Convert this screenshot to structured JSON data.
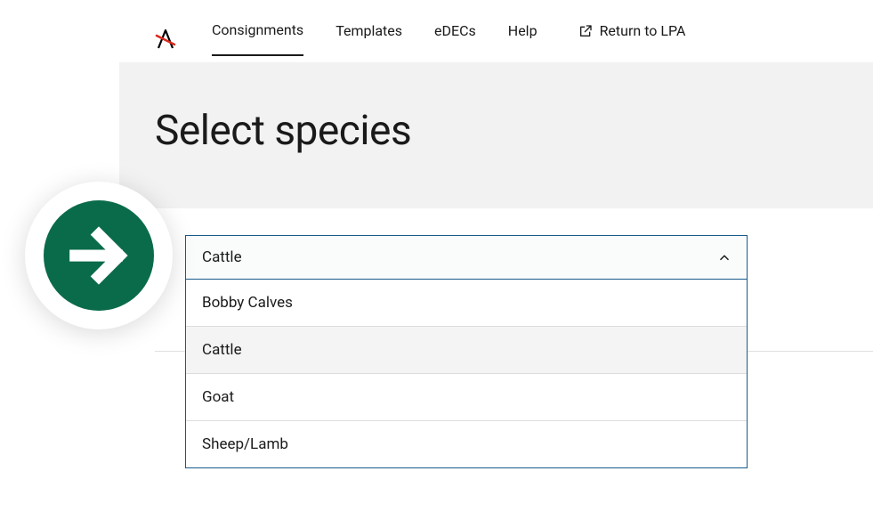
{
  "nav": {
    "items": [
      {
        "label": "Consignments",
        "active": true
      },
      {
        "label": "Templates",
        "active": false
      },
      {
        "label": "eDECs",
        "active": false
      },
      {
        "label": "Help",
        "active": false
      }
    ],
    "return_label": "Return to LPA"
  },
  "page": {
    "title": "Select species"
  },
  "select": {
    "selected": "Cattle",
    "options": [
      {
        "label": "Bobby Calves",
        "highlighted": false
      },
      {
        "label": "Cattle",
        "highlighted": true
      },
      {
        "label": "Goat",
        "highlighted": false
      },
      {
        "label": "Sheep/Lamb",
        "highlighted": false
      }
    ]
  }
}
